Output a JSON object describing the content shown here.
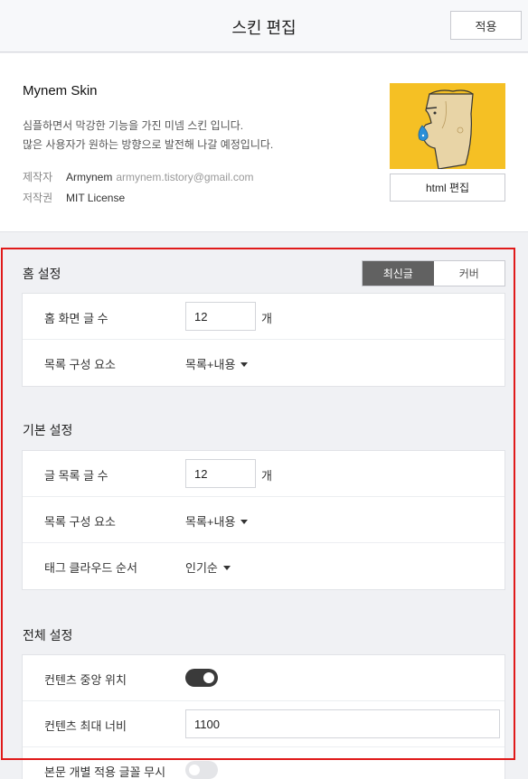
{
  "header": {
    "title": "스킨 편집",
    "apply_label": "적용"
  },
  "skin": {
    "name": "Mynem Skin",
    "desc_line1": "심플하면서 막강한 기능을 가진 미넴 스킨 입니다.",
    "desc_line2": "많은 사용자가 원하는 방향으로 발전해 나갈 예정입니다.",
    "maker_key": "제작자",
    "maker_name": "Armynem",
    "maker_email": "armynem.tistory@gmail.com",
    "license_key": "저작권",
    "license_value": "MIT License",
    "html_edit_label": "html 편집"
  },
  "home": {
    "title": "홈 설정",
    "seg_latest": "최신글",
    "seg_cover": "커버",
    "count_label": "홈 화면 글 수",
    "count_value": "12",
    "count_unit": "개",
    "list_label": "목록 구성 요소",
    "list_value": "목록+내용"
  },
  "basic": {
    "title": "기본 설정",
    "count_label": "글 목록 글 수",
    "count_value": "12",
    "count_unit": "개",
    "list_label": "목록 구성 요소",
    "list_value": "목록+내용",
    "tag_label": "태그 클라우드 순서",
    "tag_value": "인기순"
  },
  "global": {
    "title": "전체 설정",
    "center_label": "컨텐츠 중앙 위치",
    "center_on": true,
    "maxw_label": "컨텐츠 최대 너비",
    "maxw_value": "1100",
    "font_label": "본문 개별 적용 글꼴 무시",
    "font_on": false
  },
  "colors": {
    "accent_dark": "#616161",
    "highlight": "#e01a1a",
    "thumb_bg": "#f5c024"
  }
}
